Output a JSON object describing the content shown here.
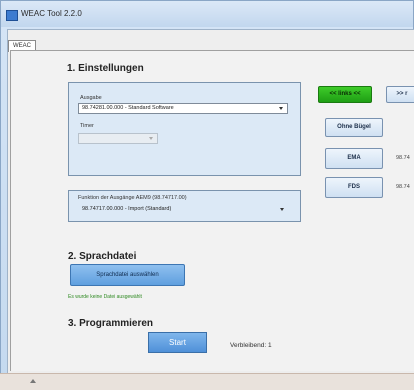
{
  "window": {
    "title": "WEAC Tool 2.2.0"
  },
  "tabs": [
    {
      "label": "WEAC"
    }
  ],
  "section1": {
    "title": "1. Einstellungen",
    "ausgabe_label": "Ausgabe",
    "ausgabe_value": "98.74281.00.000 - Standard Software",
    "timer_label": "Timer",
    "timer_value": "",
    "funktion_label": "Funktion der Ausgänge AEM9 (98.74717.00)",
    "funktion_value": "98.74717.00.000 - Import (Standard)",
    "buttons": {
      "links": "<< links <<",
      "rechts": ">> r",
      "bugel": "Ohne Bügel",
      "ema": "EMA",
      "fds": "FDS"
    },
    "ema_value": "98.74",
    "fds_value": "98.74"
  },
  "section2": {
    "title": "2. Sprachdatei",
    "choose_button": "Sprachdatei auswählen",
    "status": "Es wurde keine Datei ausgewählt"
  },
  "section3": {
    "title": "3. Programmieren",
    "start_button": "Start",
    "remaining_label": "Verbleibend:",
    "remaining_value": "1"
  },
  "colors": {
    "panel_bg": "#dce9f6",
    "green_button": "#2fb61f",
    "blue_button": "#6ea8e6",
    "status_green": "#2f8a22"
  },
  "icons": [
    "app-icon",
    "dropdown-arrow-icon",
    "resize-grip-icon"
  ]
}
